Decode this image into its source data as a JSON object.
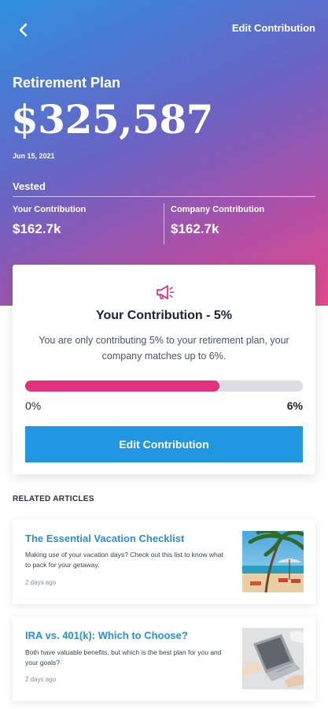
{
  "header": {
    "back_icon": "chevron-left-icon",
    "edit_link": "Edit Contribution"
  },
  "plan": {
    "title": "Retirement Plan",
    "balance": "$325,587",
    "date": "Jun 15, 2021",
    "vested_label": "Vested",
    "your_contribution_label": "Your Contribution",
    "your_contribution_value": "$162.7k",
    "company_contribution_label": "Company Contribution",
    "company_contribution_value": "$162.7k"
  },
  "contribution_card": {
    "icon": "megaphone-icon",
    "title": "Your Contribution - 5%",
    "description": "You are only contributing 5% to your retirement plan, your company matches up to 6%.",
    "progress_fraction": 0.7,
    "progress_min_label": "0%",
    "progress_max_label": "6%",
    "button_label": "Edit Contribution",
    "accent_color": "#e2317f",
    "button_color": "#2196e3"
  },
  "related": {
    "section_title": "RELATED ARTICLES",
    "articles": [
      {
        "title": "The Essential Vacation Checklist",
        "description": "Making use of your vacation days? Check out this list to know what to pack for your getaway.",
        "time": "2 days ago",
        "thumb": "beach-image"
      },
      {
        "title": "IRA vs. 401(k): Which to Choose?",
        "description": "Both have valuable benefits, but which is the best plan for you and your goals?",
        "time": "2 days ago",
        "thumb": "laptop-image"
      }
    ]
  }
}
